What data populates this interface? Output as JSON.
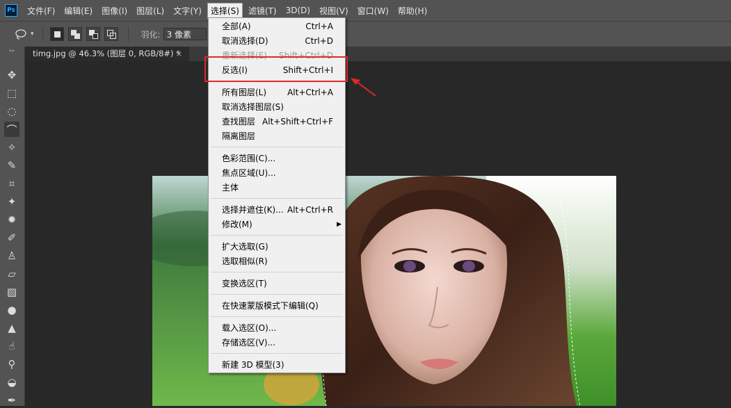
{
  "app": {
    "logo_text": "Ps"
  },
  "menubar": {
    "items": [
      "文件(F)",
      "编辑(E)",
      "图像(I)",
      "图层(L)",
      "文字(Y)",
      "选择(S)",
      "滤镜(T)",
      "3D(D)",
      "视图(V)",
      "窗口(W)",
      "帮助(H)"
    ],
    "active": "选择(S)"
  },
  "options": {
    "tool_icon": "lasso-icon",
    "feather_label": "羽化:",
    "feather_value": "3 像素"
  },
  "document": {
    "tab_title": "timg.jpg @ 46.3% (图层 0, RGB/8#) *",
    "close_glyph": "×"
  },
  "select_menu": {
    "groups": [
      [
        {
          "label": "全部(A)",
          "shortcut": "Ctrl+A"
        },
        {
          "label": "取消选择(D)",
          "shortcut": "Ctrl+D"
        },
        {
          "label": "重新选择(E)",
          "shortcut": "Shift+Ctrl+D",
          "disabled": true
        },
        {
          "label": "反选(I)",
          "shortcut": "Shift+Ctrl+I",
          "highlighted": true
        }
      ],
      [
        {
          "label": "所有图层(L)",
          "shortcut": "Alt+Ctrl+A"
        },
        {
          "label": "取消选择图层(S)",
          "shortcut": ""
        },
        {
          "label": "查找图层",
          "shortcut": "Alt+Shift+Ctrl+F"
        },
        {
          "label": "隔离图层",
          "shortcut": ""
        }
      ],
      [
        {
          "label": "色彩范围(C)...",
          "shortcut": ""
        },
        {
          "label": "焦点区域(U)...",
          "shortcut": ""
        },
        {
          "label": "主体",
          "shortcut": ""
        }
      ],
      [
        {
          "label": "选择并遮住(K)...",
          "shortcut": "Alt+Ctrl+R"
        },
        {
          "label": "修改(M)",
          "shortcut": "",
          "submenu": true
        }
      ],
      [
        {
          "label": "扩大选取(G)",
          "shortcut": ""
        },
        {
          "label": "选取相似(R)",
          "shortcut": ""
        }
      ],
      [
        {
          "label": "变换选区(T)",
          "shortcut": ""
        }
      ],
      [
        {
          "label": "在快速蒙版模式下编辑(Q)",
          "shortcut": ""
        }
      ],
      [
        {
          "label": "载入选区(O)...",
          "shortcut": ""
        },
        {
          "label": "存储选区(V)...",
          "shortcut": ""
        }
      ],
      [
        {
          "label": "新建 3D 模型(3)",
          "shortcut": ""
        }
      ]
    ]
  },
  "tools": [
    "move-icon",
    "rect-marquee-icon",
    "ellipse-marquee-icon",
    "lasso-icon",
    "magic-wand-icon",
    "quick-selection-icon",
    "crop-icon",
    "healing-brush-icon",
    "patch-icon",
    "brush-icon",
    "clone-stamp-icon",
    "eraser-icon",
    "gradient-icon",
    "blur-icon",
    "sharpen-icon",
    "smudge-icon",
    "dodge-icon",
    "sponge-icon",
    "pen-icon"
  ],
  "annotation": {
    "box_color": "#e2262b",
    "arrow_color": "#e2262b"
  }
}
